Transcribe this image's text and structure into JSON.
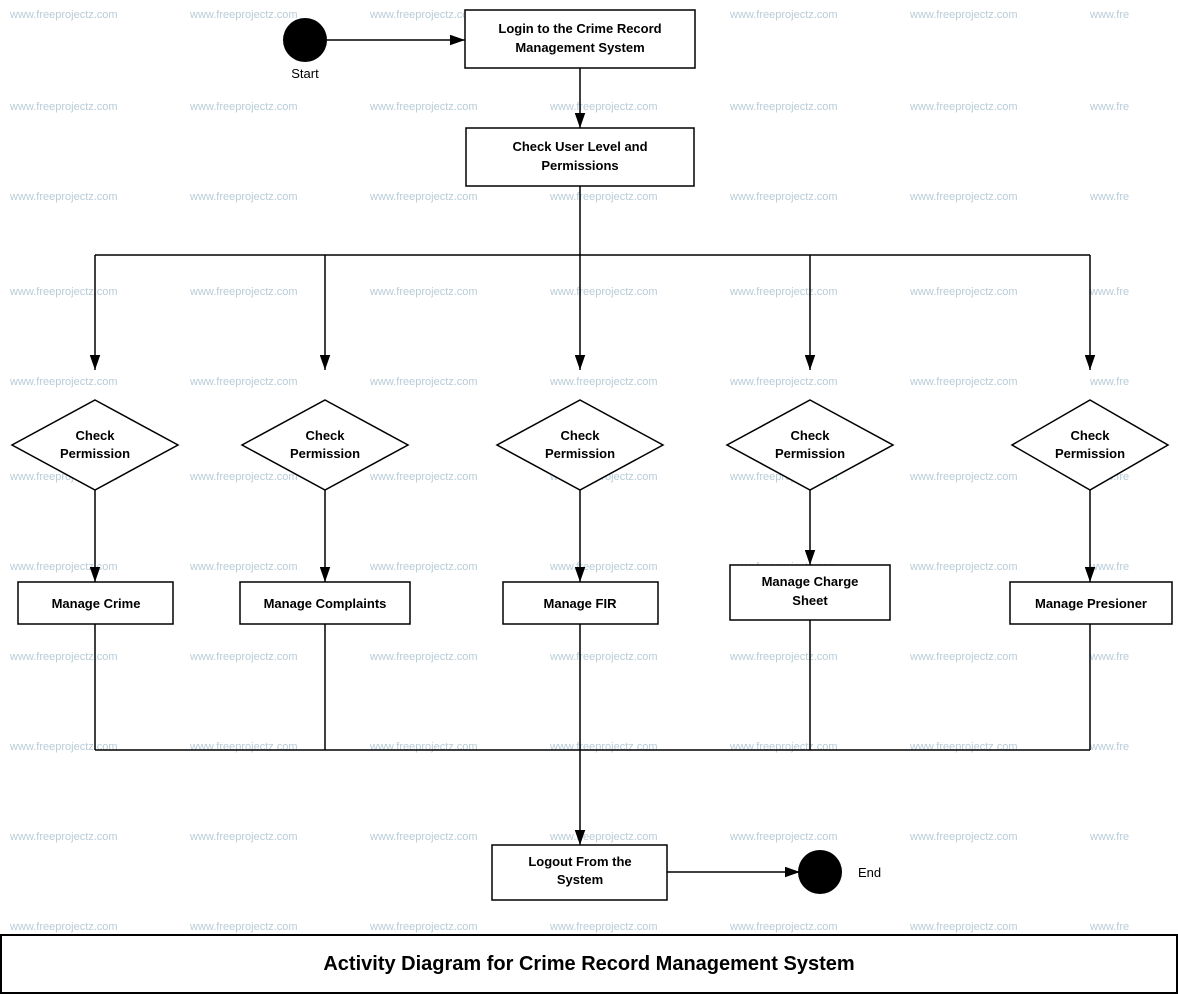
{
  "diagram": {
    "title": "Activity Diagram for Crime Record Management System",
    "nodes": {
      "start_label": "Start",
      "end_label": "End",
      "login": "Login to the Crime Record Management System",
      "check_user_level": "Check User Level and Permissions",
      "check_perm1": "Check Permission",
      "check_perm2": "Check Permission",
      "check_perm3": "Check Permission",
      "check_perm4": "Check Permission",
      "check_perm5": "Check Permission",
      "manage_crime": "Manage Crime",
      "manage_complaints": "Manage Complaints",
      "manage_fir": "Manage FIR",
      "manage_charge_sheet": "Manage Charge Sheet",
      "manage_prisoner": "Manage Presioner",
      "logout": "Logout From the System"
    },
    "watermark": "www.freeprojectz.com"
  }
}
